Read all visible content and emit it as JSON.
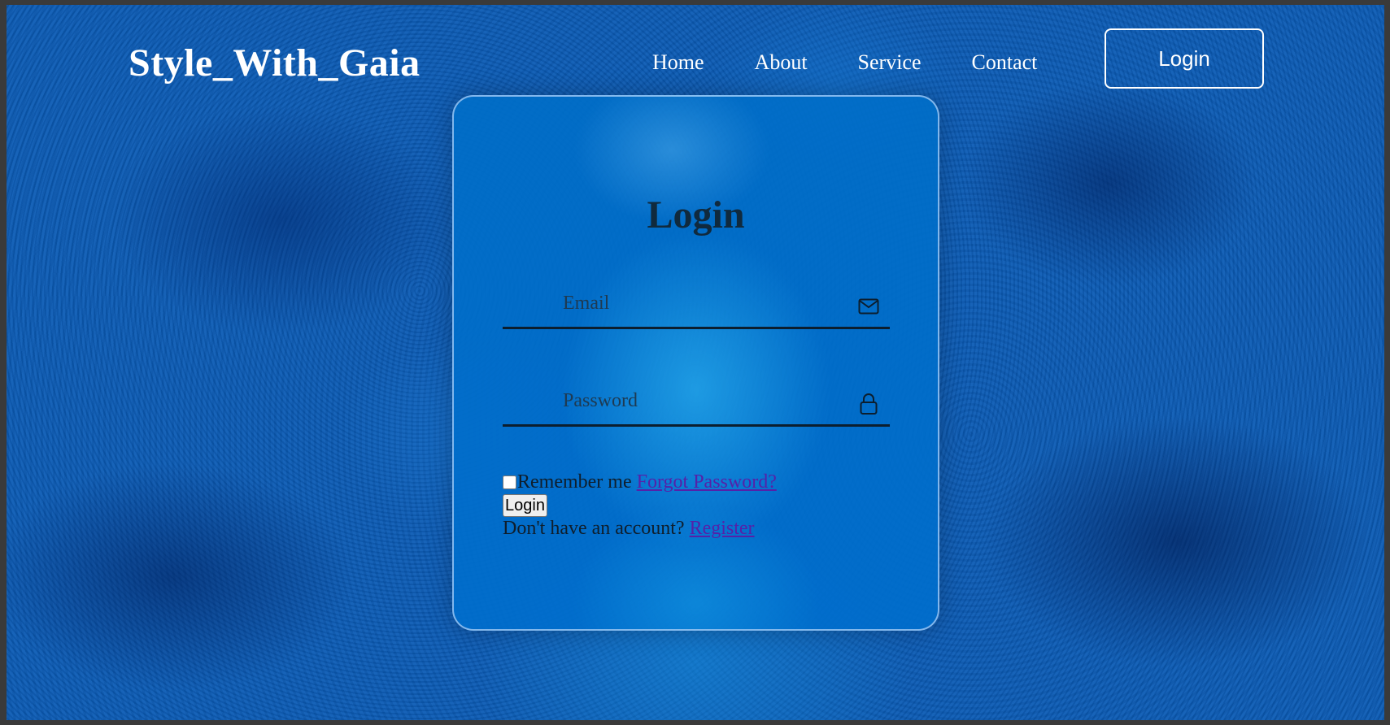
{
  "header": {
    "brand": "Style_With_Gaia",
    "nav": [
      "Home",
      "About",
      "Service",
      "Contact"
    ],
    "login_button": "Login"
  },
  "form": {
    "title": "Login",
    "email_placeholder": "Email",
    "password_placeholder": "Password",
    "email_icon": "mail-icon",
    "password_icon": "lock-icon",
    "remember_label": "Remember me",
    "forgot_link": "Forgot Password?",
    "submit_label": "Login",
    "register_prompt": "Don't have an account?",
    "register_link": "Register"
  },
  "colors": {
    "background": "#0b5bb5",
    "card_border": "#c8e1ff",
    "text_dark": "#102a3e",
    "link": "#5521a8"
  }
}
